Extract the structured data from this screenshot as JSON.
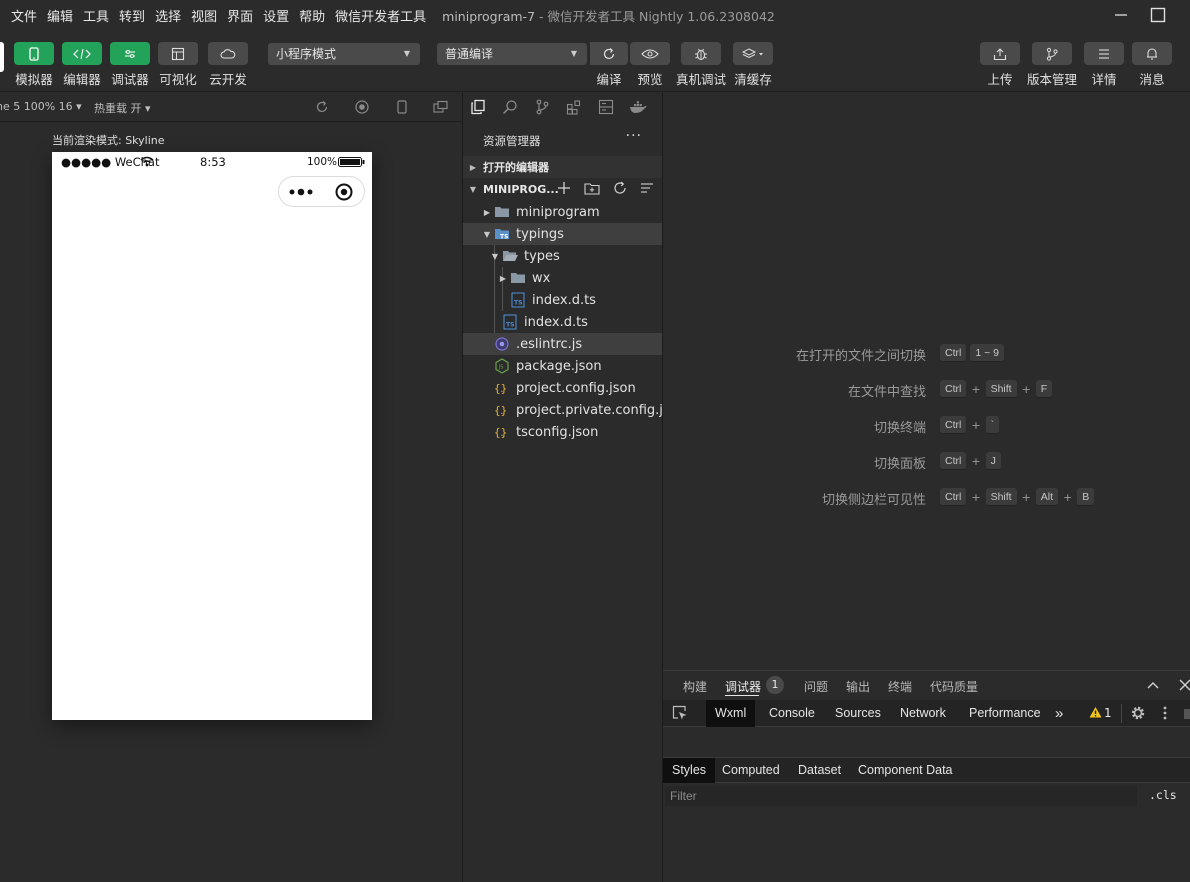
{
  "menubar": {
    "items": [
      "文件",
      "编辑",
      "工具",
      "转到",
      "选择",
      "视图",
      "界面",
      "设置",
      "帮助",
      "微信开发者工具"
    ],
    "project": "miniprogram-7",
    "window_title": " - 微信开发者工具 Nightly 1.06.2308042"
  },
  "toolbar": {
    "buttons": [
      {
        "label": "模拟器",
        "icon": "phone-icon",
        "style": "green"
      },
      {
        "label": "编辑器",
        "icon": "code-icon",
        "style": "green"
      },
      {
        "label": "调试器",
        "icon": "debug-icon",
        "style": "green"
      },
      {
        "label": "可视化",
        "icon": "layout-icon",
        "style": "gray"
      },
      {
        "label": "云开发",
        "icon": "cloud-icon",
        "style": "gray"
      }
    ],
    "mode_select": "小程序模式",
    "compile_select": "普通编译",
    "actions": [
      {
        "label": "编译",
        "icon": "refresh-icon"
      },
      {
        "label": "预览",
        "icon": "eye-icon"
      },
      {
        "label": "真机调试",
        "icon": "bug-icon"
      },
      {
        "label": "清缓存",
        "icon": "layers-icon"
      }
    ],
    "right_actions": [
      {
        "label": "上传",
        "icon": "upload-icon"
      },
      {
        "label": "版本管理",
        "icon": "branch-icon"
      },
      {
        "label": "详情",
        "icon": "menu-icon"
      },
      {
        "label": "消息",
        "icon": "bell-icon"
      }
    ]
  },
  "simulator": {
    "device": "ne 5 100% 16",
    "hot_reload": "热重载 开",
    "render_mode": "当前渲染模式: Skyline",
    "status": {
      "carrier": "●●●●● WeChat",
      "time": "8:53",
      "battery": "100%"
    }
  },
  "explorer": {
    "title": "资源管理器",
    "more": "···",
    "open_editors": "打开的编辑器",
    "project_section": "MINIPROG...",
    "tree": [
      {
        "name": "miniprogram",
        "type": "folder",
        "depth": 0,
        "expanded": false
      },
      {
        "name": "typings",
        "type": "ts-folder",
        "depth": 0,
        "expanded": true,
        "selected": true
      },
      {
        "name": "types",
        "type": "folder-open",
        "depth": 1,
        "expanded": true
      },
      {
        "name": "wx",
        "type": "folder",
        "depth": 2,
        "expanded": false
      },
      {
        "name": "index.d.ts",
        "type": "ts",
        "depth": 2
      },
      {
        "name": "index.d.ts",
        "type": "ts",
        "depth": 1
      },
      {
        "name": ".eslintrc.js",
        "type": "eslint",
        "depth": 0,
        "selected": true
      },
      {
        "name": "package.json",
        "type": "npm",
        "depth": 0
      },
      {
        "name": "project.config.json",
        "type": "json",
        "depth": 0
      },
      {
        "name": "project.private.config.js...",
        "type": "json",
        "depth": 0
      },
      {
        "name": "tsconfig.json",
        "type": "json",
        "depth": 0
      }
    ]
  },
  "editor": {
    "shortcuts": [
      {
        "label": "在打开的文件之间切换",
        "keys": [
          "Ctrl",
          "1 ~ 9"
        ],
        "plus": false
      },
      {
        "label": "在文件中查找",
        "keys": [
          "Ctrl",
          "Shift",
          "F"
        ],
        "plus": true
      },
      {
        "label": "切换终端",
        "keys": [
          "Ctrl",
          "`"
        ],
        "plus": true
      },
      {
        "label": "切换面板",
        "keys": [
          "Ctrl",
          "J"
        ],
        "plus": true
      },
      {
        "label": "切换侧边栏可见性",
        "keys": [
          "Ctrl",
          "Shift",
          "Alt",
          "B"
        ],
        "plus": true
      }
    ]
  },
  "panel": {
    "tabs": [
      "构建",
      "调试器",
      "问题",
      "输出",
      "终端",
      "代码质量"
    ],
    "debugger_badge": "1",
    "devtools_tabs": [
      "Wxml",
      "Console",
      "Sources",
      "Network",
      "Performance"
    ],
    "more_tabs": "»",
    "warning_count": "1",
    "styles_tabs": [
      "Styles",
      "Computed",
      "Dataset",
      "Component Data"
    ],
    "filter_placeholder": "Filter",
    "cls": ".cls"
  }
}
